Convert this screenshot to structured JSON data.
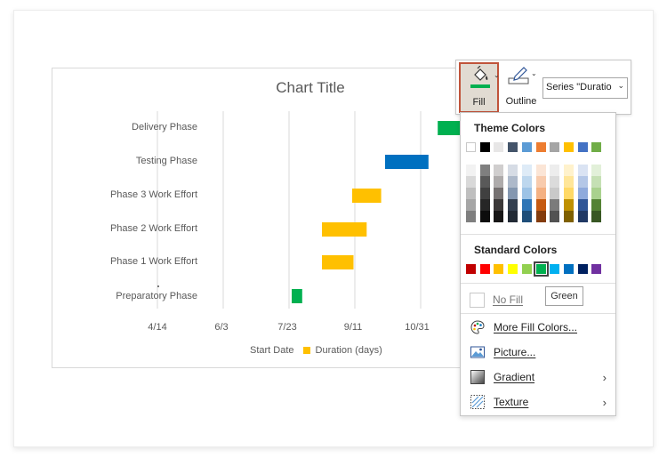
{
  "chart": {
    "title": "Chart Title",
    "categories": [
      "Delivery Phase",
      "Testing Phase",
      "Phase 3 Work Effort",
      "Phase 2 Work Effort",
      "Phase 1 Work Effort",
      "Preparatory Phase"
    ],
    "x_ticks": [
      "4/14",
      "6/3",
      "7/23",
      "9/11",
      "10/31"
    ],
    "legend": {
      "start_label": "Start Date",
      "duration_label": "Duration (days)"
    }
  },
  "chart_data": {
    "type": "bar",
    "orientation": "horizontal",
    "stacked": true,
    "categories": [
      "Delivery Phase",
      "Testing Phase",
      "Phase 3 Work Effort",
      "Phase 2 Work Effort",
      "Phase 1 Work Effort",
      "Preparatory Phase"
    ],
    "series": [
      {
        "name": "Start Date",
        "values": [
          "11/13",
          "10/4",
          "9/9",
          "8/17",
          "8/17",
          "7/25"
        ],
        "visible": false
      },
      {
        "name": "Duration (days)",
        "values": [
          30,
          33,
          22,
          34,
          24,
          8
        ]
      }
    ],
    "bar_colors": [
      "#00b050",
      "#0070c0",
      "#ffc000",
      "#ffc000",
      "#ffc000",
      "#00b050"
    ],
    "x_ticks": [
      "4/14",
      "6/3",
      "7/23",
      "9/11",
      "10/31"
    ],
    "title": "Chart Title",
    "grid": true,
    "legend_position": "bottom"
  },
  "toolbar": {
    "fill_label": "Fill",
    "outline_label": "Outline",
    "series_value": "Series \"Duratio",
    "fill_color": "#00b050"
  },
  "menu": {
    "theme_colors_label": "Theme Colors",
    "standard_colors_label": "Standard Colors",
    "theme_row": [
      "#ffffff",
      "#000000",
      "#e7e6e6",
      "#44546a",
      "#5b9bd5",
      "#ed7d31",
      "#a5a5a5",
      "#ffc000",
      "#4472c4",
      "#70ad47"
    ],
    "theme_shades": [
      [
        "#f2f2f2",
        "#7f7f7f",
        "#d0cece",
        "#d6dce5",
        "#deebf7",
        "#fbe5d6",
        "#ededed",
        "#fff2cc",
        "#dae3f3",
        "#e2f0d9"
      ],
      [
        "#d9d9d9",
        "#595959",
        "#aeabab",
        "#adb9ca",
        "#bdd7ee",
        "#f8cbad",
        "#dbdbdb",
        "#ffe699",
        "#b4c7e7",
        "#c5e0b4"
      ],
      [
        "#bfbfbf",
        "#404040",
        "#767171",
        "#8497b0",
        "#9dc3e6",
        "#f4b183",
        "#c9c9c9",
        "#ffd966",
        "#8faadc",
        "#a9d18e"
      ],
      [
        "#a6a6a6",
        "#262626",
        "#3b3838",
        "#333f50",
        "#2e75b6",
        "#c55a11",
        "#7b7b7b",
        "#bf9000",
        "#2f5597",
        "#548235"
      ],
      [
        "#7f7f7f",
        "#0d0d0d",
        "#171616",
        "#222a35",
        "#1f4e79",
        "#843c0c",
        "#525252",
        "#7f6000",
        "#203864",
        "#385723"
      ]
    ],
    "standard_row": [
      "#c00000",
      "#ff0000",
      "#ffc000",
      "#ffff00",
      "#92d050",
      "#00b050",
      "#00b0f0",
      "#0070c0",
      "#002060",
      "#7030a0"
    ],
    "no_fill_label": "No Fill",
    "more_colors_label": "More Fill Colors...",
    "picture_label": "Picture...",
    "gradient_label": "Gradient",
    "texture_label": "Texture",
    "tooltip": "Green"
  }
}
